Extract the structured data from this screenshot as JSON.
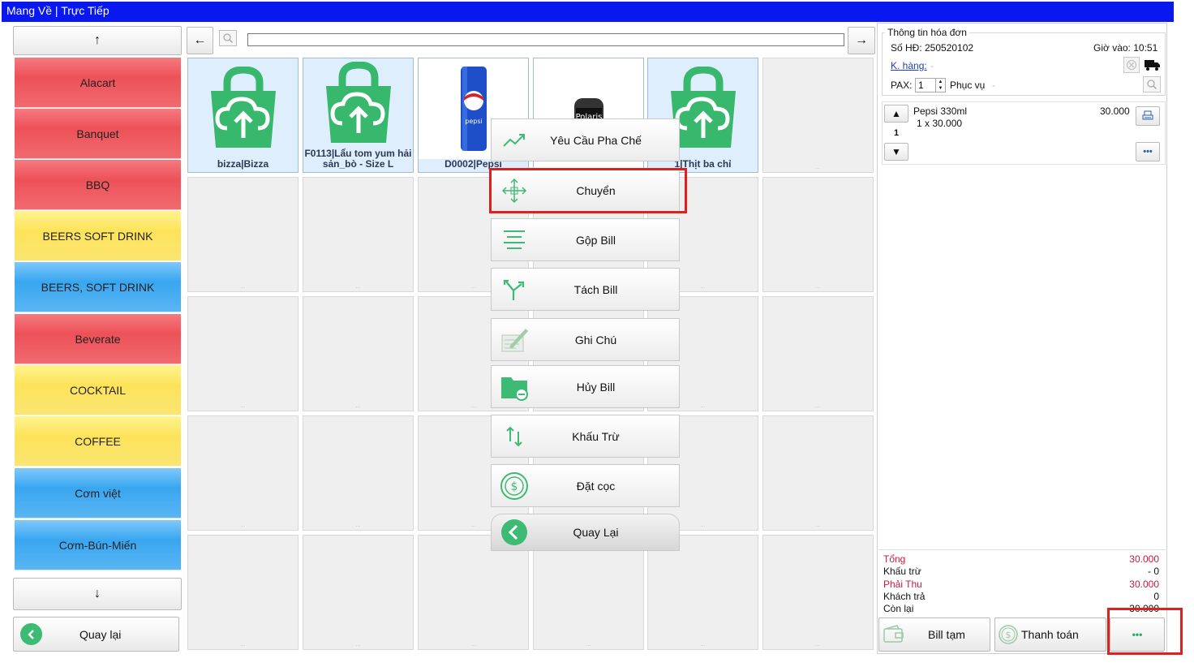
{
  "title_bar": "Mang Về | Trực Tiếp",
  "nav": {
    "up_arrow": "↑",
    "down_arrow": "↓",
    "back_label": "Quay lại",
    "left_arrow": "←",
    "right_arrow": "→",
    "search_value": ""
  },
  "categories": [
    {
      "label": "Alacart",
      "color": "red"
    },
    {
      "label": "Banquet",
      "color": "red"
    },
    {
      "label": "BBQ",
      "color": "red"
    },
    {
      "label": "BEERS SOFT DRINK",
      "color": "yellow"
    },
    {
      "label": "BEERS, SOFT DRINK",
      "color": "blue"
    },
    {
      "label": "Beverate",
      "color": "red"
    },
    {
      "label": "COCKTAIL",
      "color": "yellow"
    },
    {
      "label": "COFFEE",
      "color": "yellow"
    },
    {
      "label": "Cơm việt",
      "color": "blue"
    },
    {
      "label": "Cơm-Bún-Miến",
      "color": "blue"
    }
  ],
  "products": [
    {
      "name": "bizza|Bizza",
      "icon": "cloud-bag-icon"
    },
    {
      "name": "F0113|Lẩu tom yum hải sản_bò - Size L",
      "icon": "cloud-bag-icon"
    },
    {
      "name": "D0002|Pepsi",
      "icon": "pepsi-can-icon",
      "can_text": "pepsi"
    },
    {
      "name": "",
      "icon": "polaris-bottle-icon",
      "logo_text": "Polaris"
    },
    {
      "name": "1|Thịt ba chỉ",
      "icon": "cloud-bag-icon"
    }
  ],
  "empty_cell_mark": "...",
  "context_menu": [
    {
      "label": "Yêu Cầu Pha Chế",
      "icon": "trend-icon"
    },
    {
      "label": "Chuyển",
      "icon": "move-icon"
    },
    {
      "label": "Gộp Bill",
      "icon": "merge-lines-icon"
    },
    {
      "label": "Tách Bill",
      "icon": "split-icon"
    },
    {
      "label": "Ghi Chú",
      "icon": "note-pen-icon"
    },
    {
      "label": "Hủy Bill",
      "icon": "folder-cancel-icon"
    },
    {
      "label": "Khấu Trừ",
      "icon": "up-down-arrows-icon"
    },
    {
      "label": "Đặt cọc",
      "icon": "dollar-coin-icon"
    },
    {
      "label": "Quay Lại",
      "icon": "back-circle-icon"
    }
  ],
  "invoice": {
    "section_title": "Thông tin hóa đơn",
    "invoice_no": "Số HĐ: 250520102",
    "time_in": "Giờ vào: 10:51",
    "customer_link": "K. hàng:",
    "customer_dash": "-",
    "pax_label": "PAX:",
    "pax_value": "1",
    "serve_label": "Phục vụ",
    "serve_dash": "-"
  },
  "order_items": [
    {
      "name": "Pepsi 330ml",
      "price": "30.000",
      "detail": "1 x 30.000",
      "qty": "1"
    }
  ],
  "totals": {
    "total_label": "Tổng",
    "total_value": "30.000",
    "deduct_label": "Khấu trừ",
    "deduct_value": "- 0",
    "payable_label": "Phải Thu",
    "payable_value": "30.000",
    "paid_label": "Khách trả",
    "paid_value": "0",
    "remain_label": "Còn lại",
    "remain_value": "30.000"
  },
  "actions": {
    "temp_bill": "Bill tạm",
    "pay": "Thanh toán",
    "more": "•••"
  },
  "colors": {
    "title_bar": "#0a18f0",
    "accent_green": "#2fb86a",
    "highlight_red": "#e0201c",
    "total_red": "#c8193c"
  }
}
